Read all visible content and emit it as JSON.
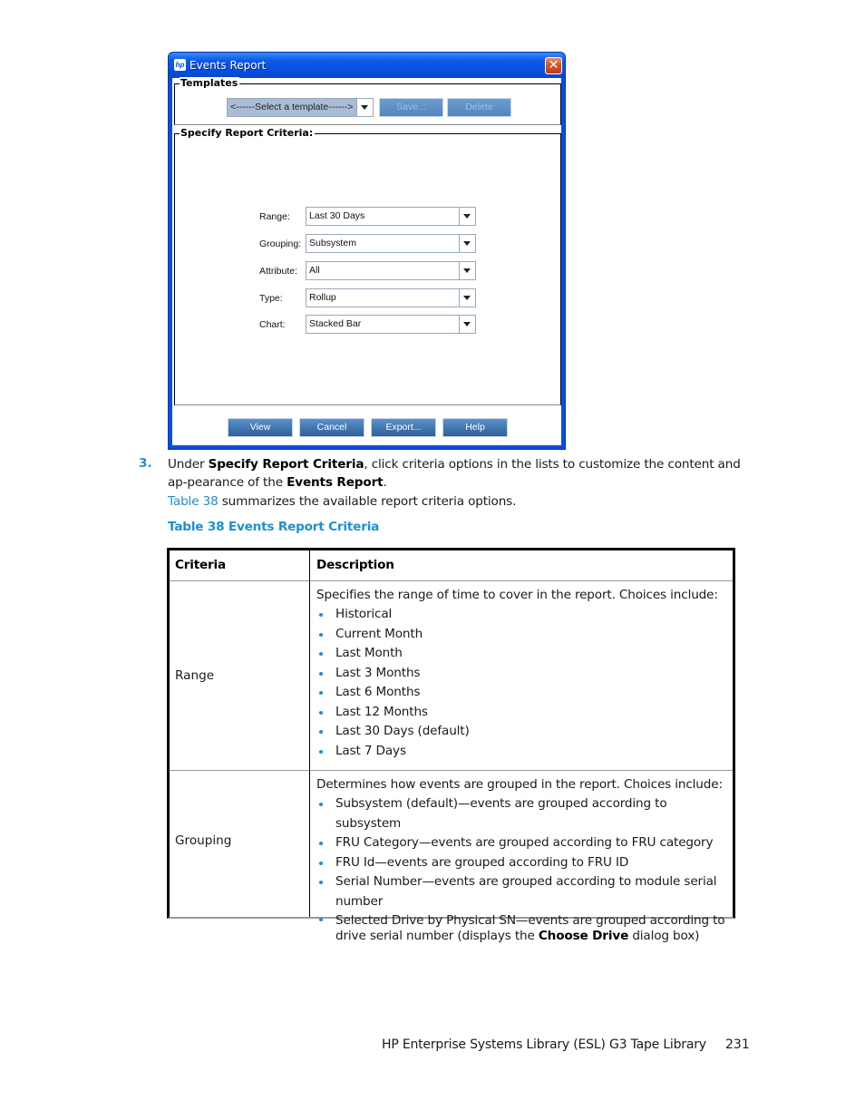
{
  "dialog": {
    "title": "Events Report",
    "logo_icon": "hp-logo-icon",
    "close_icon": "close-icon",
    "templates": {
      "legend": "Templates",
      "select_value": "<------Select a template------>",
      "save_label": "Save...",
      "delete_label": "Delete"
    },
    "criteria": {
      "legend": "Specify Report Criteria:",
      "fields": [
        {
          "label": "Range:",
          "value": "Last 30 Days"
        },
        {
          "label": "Grouping:",
          "value": "Subsystem"
        },
        {
          "label": "Attribute:",
          "value": "All"
        },
        {
          "label": "Type:",
          "value": "Rollup"
        },
        {
          "label": "Chart:",
          "value": "Stacked Bar"
        }
      ]
    },
    "buttons": {
      "view": "View",
      "cancel": "Cancel",
      "export": "Export...",
      "help": "Help"
    },
    "colors": {
      "titlebar": "#0a4ee0",
      "button": "#4a80ba",
      "close": "#d2522c"
    }
  },
  "step": {
    "number": "3.",
    "text_1": "Under ",
    "bold_1": "Specify Report Criteria",
    "text_2": ", click criteria options in the lists to customize the content and ap-pearance of the ",
    "bold_2": "Events Report",
    "text_3": "."
  },
  "summary": {
    "link": "Table 38",
    "text": " summarizes the available report criteria options."
  },
  "table": {
    "caption": "Table 38 Events Report Criteria",
    "headers": [
      "Criteria",
      "Description"
    ],
    "rows": [
      {
        "criteria": "Range",
        "intro": "Specifies the range of time to cover in the report. Choices include:",
        "items": [
          "Historical",
          "Current Month",
          "Last Month",
          "Last 3 Months",
          "Last 6 Months",
          "Last 12 Months",
          "Last 30 Days (default)",
          "Last 7 Days"
        ]
      },
      {
        "criteria": "Grouping",
        "intro": "Determines how events are grouped in the report. Choices include:",
        "items": [
          "Subsystem (default)—events are grouped according to subsystem",
          "FRU Category—events are grouped according to FRU category",
          "FRU Id—events are grouped according to FRU ID",
          "Serial Number—events are grouped according to module serial number"
        ],
        "last_item_text": "Selected Drive by Physical SN—events are grouped according to drive serial number (displays the ",
        "last_item_bold": "Choose Drive",
        "last_item_end": " dialog box)"
      }
    ]
  },
  "footer": {
    "title": "HP Enterprise Systems Library (ESL) G3 Tape Library",
    "page": "231"
  },
  "accent_color": "#1e8fd0"
}
